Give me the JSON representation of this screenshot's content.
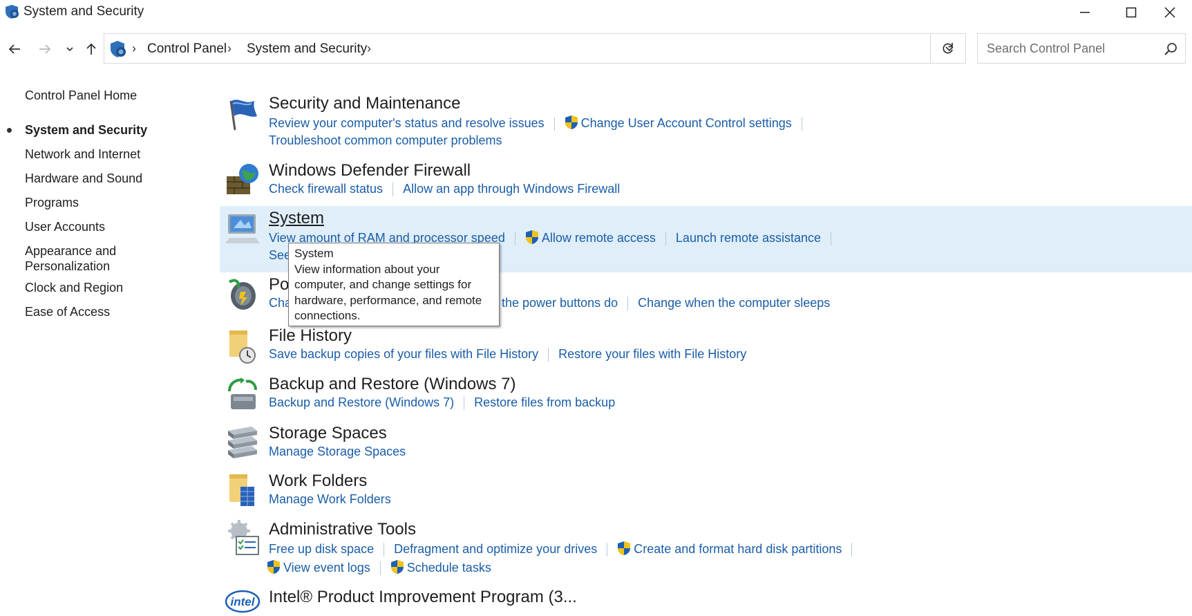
{
  "window": {
    "title": "System and Security"
  },
  "nav": {
    "breadcrumbs": [
      "Control Panel",
      "System and Security"
    ],
    "search_placeholder": "Search Control Panel"
  },
  "sidebar": {
    "items": [
      {
        "label": "Control Panel Home",
        "active": false
      },
      {
        "label": "System and Security",
        "active": true
      },
      {
        "label": "Network and Internet",
        "active": false
      },
      {
        "label": "Hardware and Sound",
        "active": false
      },
      {
        "label": "Programs",
        "active": false
      },
      {
        "label": "User Accounts",
        "active": false
      },
      {
        "label": "Appearance and\nPersonalization",
        "active": false
      },
      {
        "label": "Clock and Region",
        "active": false
      },
      {
        "label": "Ease of Access",
        "active": false
      }
    ]
  },
  "categories": [
    {
      "title": "Security and Maintenance",
      "icon": "flag-icon",
      "links": [
        [
          {
            "label": "Review your computer's status and resolve issues"
          },
          {
            "label": "Change User Account Control settings",
            "shield": true
          }
        ],
        [
          {
            "label": "Troubleshoot common computer problems"
          }
        ]
      ]
    },
    {
      "title": "Windows Defender Firewall",
      "icon": "firewall-icon",
      "links": [
        [
          {
            "label": "Check firewall status"
          },
          {
            "label": "Allow an app through Windows Firewall"
          }
        ]
      ]
    },
    {
      "title": "System",
      "icon": "computer-icon",
      "links": [
        [
          {
            "label": "View amount of RAM and processor speed"
          },
          {
            "label": "Allow remote access",
            "shield": true
          },
          {
            "label": "Launch remote assistance"
          }
        ],
        [
          {
            "label": "See"
          }
        ]
      ]
    },
    {
      "title": "Po",
      "icon": "power-options-icon",
      "links": [
        [
          {
            "label": "Cha"
          },
          {
            "label": "the power buttons do"
          },
          {
            "label": "Change when the computer sleeps"
          }
        ]
      ]
    },
    {
      "title": "File History",
      "icon": "file-history-icon",
      "links": [
        [
          {
            "label": "Save backup copies of your files with File History"
          },
          {
            "label": "Restore your files with File History"
          }
        ]
      ]
    },
    {
      "title": "Backup and Restore (Windows 7)",
      "icon": "backup-icon",
      "links": [
        [
          {
            "label": "Backup and Restore (Windows 7)"
          },
          {
            "label": "Restore files from backup"
          }
        ]
      ]
    },
    {
      "title": "Storage Spaces",
      "icon": "storage-spaces-icon",
      "links": [
        [
          {
            "label": "Manage Storage Spaces"
          }
        ]
      ]
    },
    {
      "title": "Work Folders",
      "icon": "work-folders-icon",
      "links": [
        [
          {
            "label": "Manage Work Folders"
          }
        ]
      ]
    },
    {
      "title": "Administrative Tools",
      "icon": "admin-tools-icon",
      "links": [
        [
          {
            "label": "Free up disk space"
          },
          {
            "label": "Defragment and optimize your drives"
          },
          {
            "label": "Create and format hard disk partitions",
            "shield": true
          }
        ],
        [
          {
            "label": "View event logs",
            "shield": true
          },
          {
            "label": "Schedule tasks",
            "shield": true
          }
        ]
      ]
    },
    {
      "title": "Intel® Product Improvement Program (3...",
      "icon": "intel-icon",
      "links": []
    }
  ],
  "tooltip": {
    "title": "System",
    "body": [
      "View information about your",
      "computer, and change settings for",
      "hardware, performance, and remote",
      "connections."
    ]
  },
  "colors": {
    "link": "#1a5da8",
    "hover_row": "#dfeef8",
    "text": "#1e1e1e"
  }
}
